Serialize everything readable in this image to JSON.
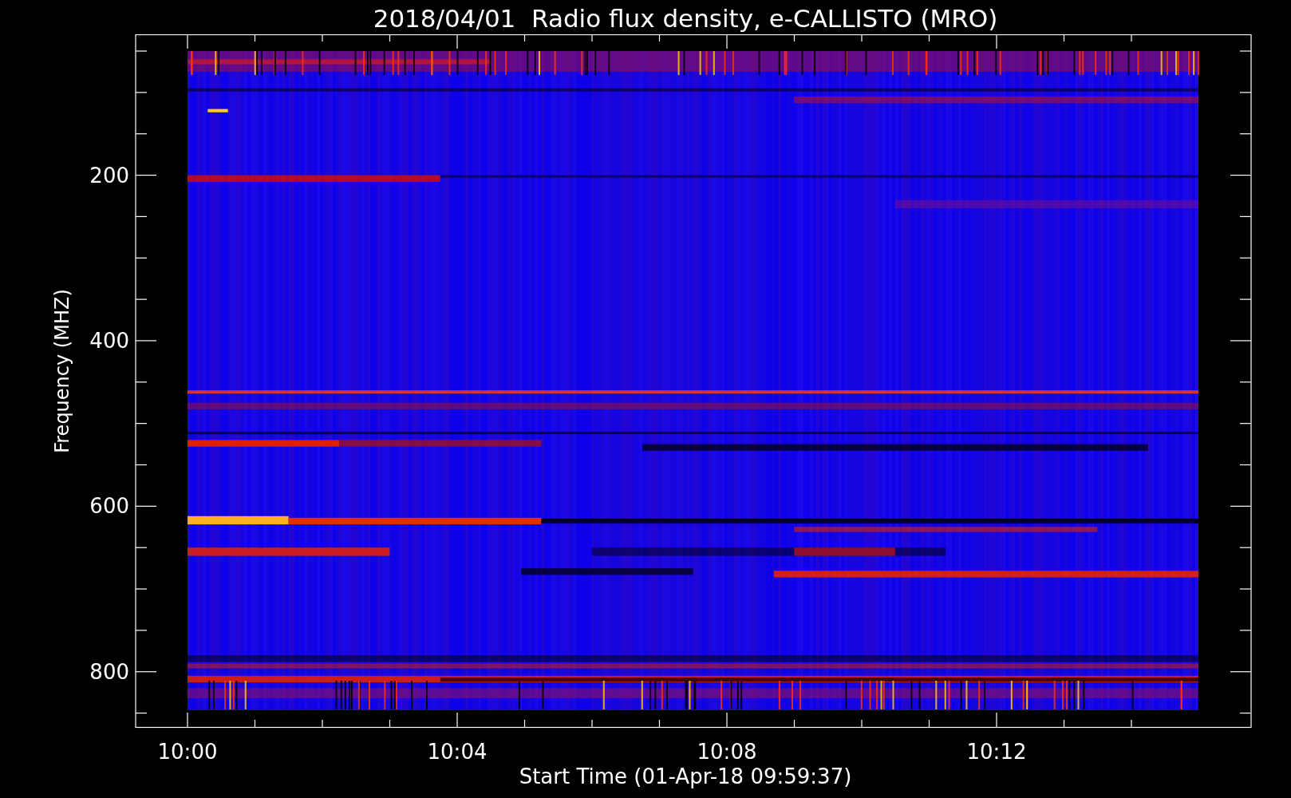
{
  "plot": {
    "title": "2018/04/01  Radio flux density, e-CALLISTO (MRO)",
    "ylabel": "Frequency (MHZ)",
    "xlabel": "Start Time (01-Apr-18 09:59:37)",
    "yticks": [
      "200",
      "400",
      "600",
      "800"
    ],
    "xticks": [
      "10:00",
      "10:04",
      "10:08",
      "10:12"
    ]
  }
}
